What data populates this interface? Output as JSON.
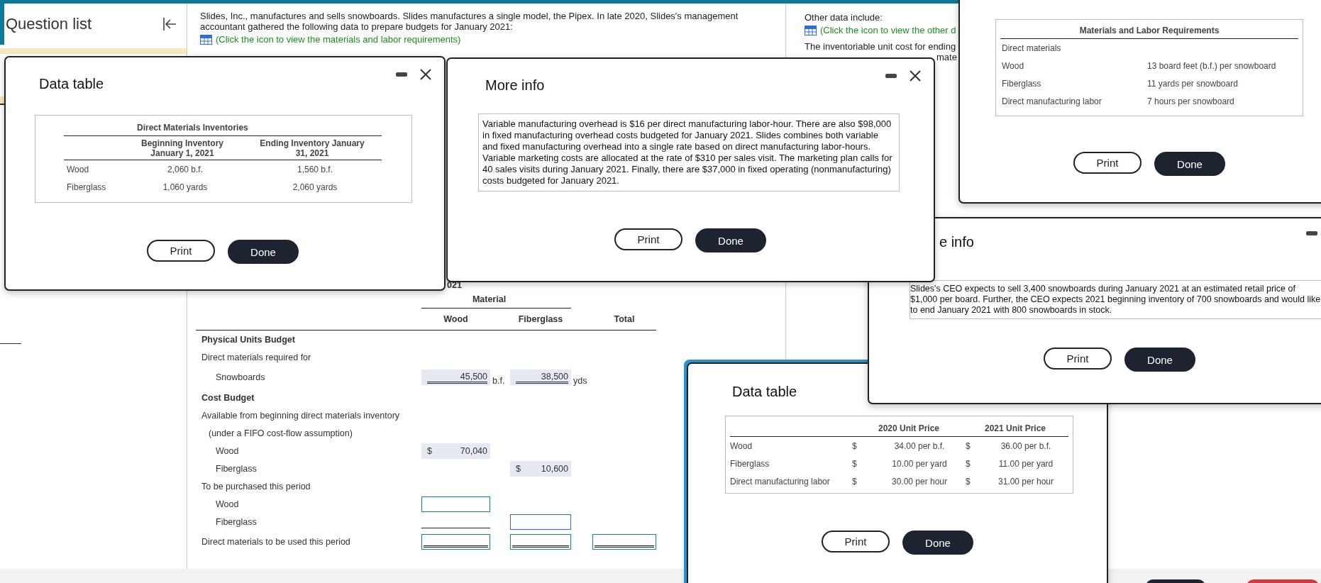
{
  "sidebar": {
    "title": "Question list"
  },
  "problem": {
    "intro": "Slides, Inc., manufactures and sells snowboards. Slides manufactures a single model, the Pipex. In late 2020, Slides's management accountant gathered the following data to prepare budgets for January 2021:",
    "link": "(Click the icon to view the materials and labor requirements)"
  },
  "other_data": {
    "heading": "Other data include:",
    "link": "(Click the icon to view the other d",
    "lines": [
      "The inventoriable unit cost for ending",
      "mate"
    ]
  },
  "budget": {
    "heading": "021",
    "group_header": "Material",
    "columns": [
      "Wood",
      "Fiberglass",
      "Total"
    ],
    "rows": [
      {
        "kind": "heading",
        "label": "Physical Units Budget",
        "cells": []
      },
      {
        "kind": "line",
        "label": "Direct materials required for",
        "cells": []
      },
      {
        "kind": "item",
        "label": "Snowboards",
        "cells": [
          {
            "kind": "value",
            "value": "45,500",
            "unit": "b.f.",
            "double_rule": true
          },
          {
            "kind": "value",
            "value": "38,500",
            "unit": "yds",
            "double_rule": true
          },
          {
            "kind": "empty"
          }
        ]
      },
      {
        "kind": "heading",
        "label": "Cost Budget",
        "cells": []
      },
      {
        "kind": "line",
        "label": "Available from beginning direct materials inventory",
        "cells": []
      },
      {
        "kind": "note",
        "label": "(under a FIFO cost-flow assumption)",
        "cells": []
      },
      {
        "kind": "item",
        "label": "Wood",
        "cells": [
          {
            "kind": "value",
            "prefix": "$",
            "value": "70,040"
          },
          {
            "kind": "empty"
          },
          {
            "kind": "empty"
          }
        ]
      },
      {
        "kind": "item",
        "label": "Fiberglass",
        "cells": [
          {
            "kind": "empty"
          },
          {
            "kind": "value",
            "prefix": "$",
            "value": "10,600"
          },
          {
            "kind": "empty"
          }
        ]
      },
      {
        "kind": "line",
        "label": "To be purchased this period",
        "cells": []
      },
      {
        "kind": "item",
        "label": "Wood",
        "cells": [
          {
            "kind": "input",
            "focused": false
          },
          {
            "kind": "empty"
          },
          {
            "kind": "empty"
          }
        ]
      },
      {
        "kind": "item",
        "label": "Fiberglass",
        "cells": [
          {
            "kind": "underline"
          },
          {
            "kind": "input",
            "focused": true
          },
          {
            "kind": "empty"
          }
        ]
      },
      {
        "kind": "line",
        "label": "Direct materials to be used this period",
        "cells": [
          {
            "kind": "input",
            "focused": false,
            "double_rule": true
          },
          {
            "kind": "input",
            "focused": false,
            "double_rule": true
          },
          {
            "kind": "input",
            "focused": false,
            "double_rule": true
          }
        ]
      }
    ]
  },
  "inventory_dialog": {
    "title": "Data table",
    "focused": false,
    "table": {
      "title": "Direct Materials Inventories",
      "columns": [
        "Beginning Inventory January 1, 2021",
        "Ending Inventory January 31, 2021"
      ],
      "rows": [
        {
          "label": "Wood",
          "values": [
            "2,060 b.f.",
            "1,560 b.f."
          ]
        },
        {
          "label": "Fiberglass",
          "values": [
            "1,060 yards",
            "2,060 yards"
          ]
        }
      ]
    },
    "buttons": [
      {
        "label": "Print",
        "primary": false
      },
      {
        "label": "Done",
        "primary": true
      }
    ]
  },
  "overhead_dialog": {
    "title": "More info",
    "focused": false,
    "text": "Variable manufacturing overhead is $16 per direct manufacturing labor-hour. There are also $98,000 in fixed manufacturing overhead costs budgeted for January 2021. Slides combines both variable and fixed manufacturing overhead into a single rate based on direct manufacturing labor-hours. Variable marketing costs are allocated at the rate of $310 per sales visit. The marketing plan calls for 40 sales visits during January 2021. Finally, there are $37,000 in fixed operating (nonmanufacturing) costs budgeted for January 2021.",
    "buttons": [
      {
        "label": "Print",
        "primary": false
      },
      {
        "label": "Done",
        "primary": true
      }
    ]
  },
  "requirements_dialog": {
    "focused": false,
    "table": {
      "title": "Materials and Labor Requirements",
      "section": "Direct materials",
      "rows": [
        {
          "label": "Wood",
          "value": "13 board feet (b.f.) per snowboard"
        },
        {
          "label": "Fiberglass",
          "value": "11 yards per snowboard"
        },
        {
          "label": "Direct manufacturing labor",
          "value": "7 hours per snowboard"
        }
      ]
    },
    "buttons": [
      {
        "label": "Print",
        "primary": false
      },
      {
        "label": "Done",
        "primary": true
      }
    ]
  },
  "sales_dialog": {
    "title": "e info",
    "focused": false,
    "text": "Slides's CEO expects to sell 3,400 snowboards during January 2021 at an estimated retail price of $1,000 per board. Further, the CEO expects 2021 beginning inventory of 700 snowboards and would like to end January 2021 with 800 snowboards in stock.",
    "buttons": [
      {
        "label": "Print",
        "primary": false
      },
      {
        "label": "Done",
        "primary": true
      }
    ]
  },
  "price_dialog": {
    "title": "Data table",
    "focused": true,
    "table": {
      "columns": [
        "2020 Unit Price",
        "2021 Unit Price"
      ],
      "rows": [
        {
          "label": "Wood",
          "values": [
            {
              "currency": "$",
              "amount": "34.00 per b.f."
            },
            {
              "currency": "$",
              "amount": "36.00 per b.f."
            }
          ]
        },
        {
          "label": "Fiberglass",
          "values": [
            {
              "currency": "$",
              "amount": "10.00 per yard"
            },
            {
              "currency": "$",
              "amount": "11.00 per yard"
            }
          ]
        },
        {
          "label": "Direct manufacturing labor",
          "values": [
            {
              "currency": "$",
              "amount": "30.00 per hour"
            },
            {
              "currency": "$",
              "amount": "31.00 per hour"
            }
          ]
        }
      ]
    },
    "buttons": [
      {
        "label": "Print",
        "primary": false
      },
      {
        "label": "Done",
        "primary": true
      }
    ]
  }
}
